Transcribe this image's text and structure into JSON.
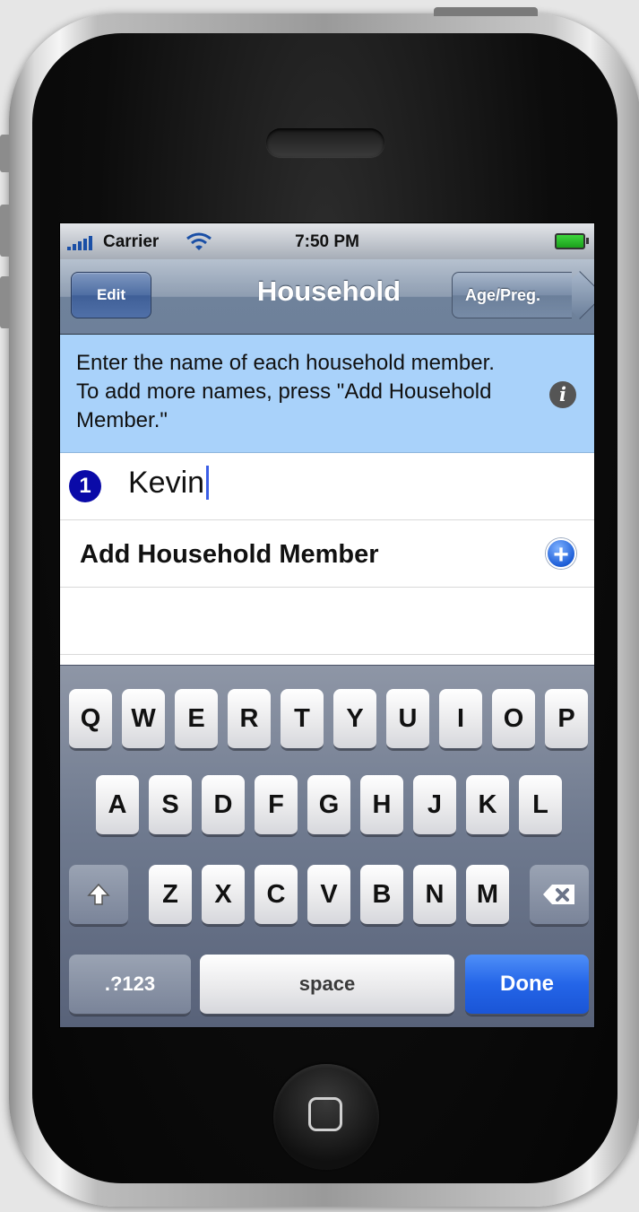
{
  "status_bar": {
    "carrier": "Carrier",
    "time": "7:50 PM"
  },
  "nav_bar": {
    "left_button": "Edit",
    "title": "Household",
    "right_button": "Age/Preg."
  },
  "banner": {
    "text": "Enter the name of each household member. To add more names, press \"Add Household Member.\""
  },
  "members": [
    {
      "number": "1",
      "name": "Kevin"
    }
  ],
  "add_row": {
    "label": "Add Household Member"
  },
  "keyboard": {
    "row1": [
      "Q",
      "W",
      "E",
      "R",
      "T",
      "Y",
      "U",
      "I",
      "O",
      "P"
    ],
    "row2": [
      "A",
      "S",
      "D",
      "F",
      "G",
      "H",
      "J",
      "K",
      "L"
    ],
    "row3": [
      "Z",
      "X",
      "C",
      "V",
      "B",
      "N",
      "M"
    ],
    "num_key": ".?123",
    "space_key": "space",
    "done_key": "Done"
  }
}
